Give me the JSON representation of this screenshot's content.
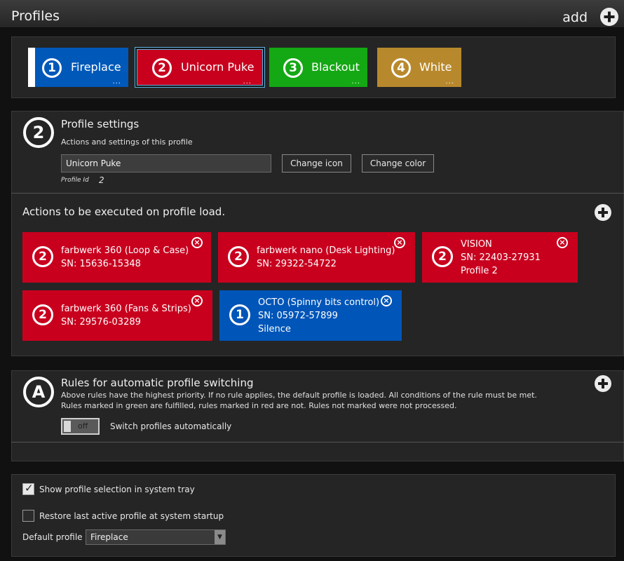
{
  "header": {
    "title": "Profiles",
    "add_label": "add"
  },
  "profiles": [
    {
      "number": "1",
      "name": "Fireplace",
      "color": "#0058b9",
      "menu": "..."
    },
    {
      "number": "2",
      "name": "Unicorn Puke",
      "color": "#c8001e",
      "menu": "..."
    },
    {
      "number": "3",
      "name": "Blackout",
      "color": "#14a814",
      "menu": "..."
    },
    {
      "number": "4",
      "name": "White",
      "color": "#b8892c",
      "menu": "..."
    }
  ],
  "profile_settings": {
    "number": "2",
    "title": "Profile settings",
    "subtitle": "Actions and settings of this profile",
    "name_value": "Unicorn Puke",
    "change_icon_label": "Change icon",
    "change_color_label": "Change color",
    "profile_id_label": "Profile Id",
    "profile_id_value": "2"
  },
  "actions": {
    "title": "Actions to be executed on profile load.",
    "cards": [
      {
        "number": "2",
        "line1": "farbwerk 360 (Loop & Case)",
        "line2": "SN: 15636-15348",
        "line3": "",
        "color": "red"
      },
      {
        "number": "2",
        "line1": "farbwerk nano (Desk Lighting)",
        "line2": "SN: 29322-54722",
        "line3": "",
        "color": "red"
      },
      {
        "number": "2",
        "line1": "VISION",
        "line2": "SN: 22403-27931",
        "line3": "Profile 2",
        "color": "red"
      },
      {
        "number": "2",
        "line1": "farbwerk 360 (Fans & Strips)",
        "line2": "SN: 29576-03289",
        "line3": "",
        "color": "red"
      },
      {
        "number": "1",
        "line1": "OCTO (Spinny bits control)",
        "line2": "SN: 05972-57899",
        "line3": "Silence",
        "color": "blue"
      }
    ],
    "close_glyph": "×"
  },
  "rules": {
    "badge": "A",
    "title": "Rules for automatic profile switching",
    "desc1": "Above rules have the highest priority. If no rule applies, the default profile is loaded. All conditions of the rule must be met.",
    "desc2": "Rules marked in green are fulfilled, rules marked in red are not. Rules not marked were not processed.",
    "toggle_state": "off",
    "toggle_label": "Switch profiles automatically"
  },
  "general": {
    "show_tray_label": "Show profile selection in system tray",
    "show_tray_checked": true,
    "restore_label": "Restore last active profile at system startup",
    "restore_checked": false,
    "default_profile_label": "Default profile",
    "default_profile_value": "Fireplace"
  }
}
